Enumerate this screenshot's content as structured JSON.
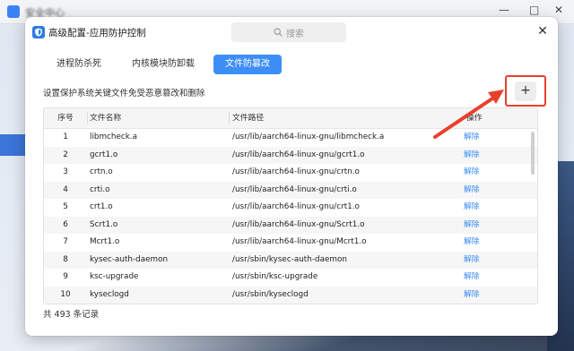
{
  "background_window": {
    "title": "安全中心",
    "controls": [
      "—",
      "□",
      "✕"
    ]
  },
  "dialog": {
    "title": "高级配置-应用防护控制",
    "search_placeholder": "搜索",
    "close_label": "✕"
  },
  "tabs": [
    {
      "label": "进程防杀死",
      "active": false
    },
    {
      "label": "内核模块防卸载",
      "active": false
    },
    {
      "label": "文件防篡改",
      "active": true
    }
  ],
  "description": "设置保护系统关键文件免受恶意篡改和删除",
  "add_button": "+",
  "table": {
    "headers": {
      "index": "序号",
      "name": "文件名称",
      "path": "文件路径",
      "action": "操作"
    },
    "rows": [
      {
        "index": "1",
        "name": "libmcheck.a",
        "path": "/usr/lib/aarch64-linux-gnu/libmcheck.a",
        "action": "解除"
      },
      {
        "index": "2",
        "name": "gcrt1.o",
        "path": "/usr/lib/aarch64-linux-gnu/gcrt1.o",
        "action": "解除"
      },
      {
        "index": "3",
        "name": "crtn.o",
        "path": "/usr/lib/aarch64-linux-gnu/crtn.o",
        "action": "解除"
      },
      {
        "index": "4",
        "name": "crti.o",
        "path": "/usr/lib/aarch64-linux-gnu/crti.o",
        "action": "解除"
      },
      {
        "index": "5",
        "name": "crt1.o",
        "path": "/usr/lib/aarch64-linux-gnu/crt1.o",
        "action": "解除"
      },
      {
        "index": "6",
        "name": "Scrt1.o",
        "path": "/usr/lib/aarch64-linux-gnu/Scrt1.o",
        "action": "解除"
      },
      {
        "index": "7",
        "name": "Mcrt1.o",
        "path": "/usr/lib/aarch64-linux-gnu/Mcrt1.o",
        "action": "解除"
      },
      {
        "index": "8",
        "name": "kysec-auth-daemon",
        "path": "/usr/sbin/kysec-auth-daemon",
        "action": "解除"
      },
      {
        "index": "9",
        "name": "ksc-upgrade",
        "path": "/usr/sbin/ksc-upgrade",
        "action": "解除"
      },
      {
        "index": "10",
        "name": "kyseclogd",
        "path": "/usr/sbin/kyseclogd",
        "action": "解除"
      }
    ]
  },
  "footer": "共 493 条记录",
  "colors": {
    "accent": "#3e8ef7",
    "highlight": "#e9402c"
  }
}
